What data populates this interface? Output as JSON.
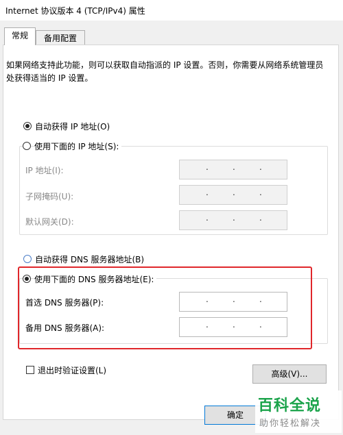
{
  "window": {
    "title": "Internet 协议版本 4 (TCP/IPv4) 属性"
  },
  "tabs": [
    {
      "label": "常规",
      "active": true
    },
    {
      "label": "备用配置",
      "active": false
    }
  ],
  "description": "如果网络支持此功能，则可以获取自动指派的 IP 设置。否则，你需要从网络系统管理员处获得适当的 IP 设置。",
  "ip": {
    "auto_label": "自动获得 IP 地址(O)",
    "manual_label": "使用下面的 IP 地址(S):",
    "fields": [
      {
        "label": "IP 地址(I):",
        "value": ""
      },
      {
        "label": "子网掩码(U):",
        "value": ""
      },
      {
        "label": "默认网关(D):",
        "value": ""
      }
    ]
  },
  "dns": {
    "auto_label": "自动获得 DNS 服务器地址(B)",
    "manual_label": "使用下面的 DNS 服务器地址(E):",
    "fields": [
      {
        "label": "首选 DNS 服务器(P):",
        "value": ""
      },
      {
        "label": "备用 DNS 服务器(A):",
        "value": ""
      }
    ]
  },
  "validate_label": "退出时验证设置(L)",
  "advanced_button": "高级(V)...",
  "ok_button": "确定",
  "watermark": {
    "text": "百科全说",
    "subtitle": "助你轻松解决"
  },
  "colors": {
    "highlight": "#e0262a",
    "watermark_green": "#1aa34a"
  }
}
